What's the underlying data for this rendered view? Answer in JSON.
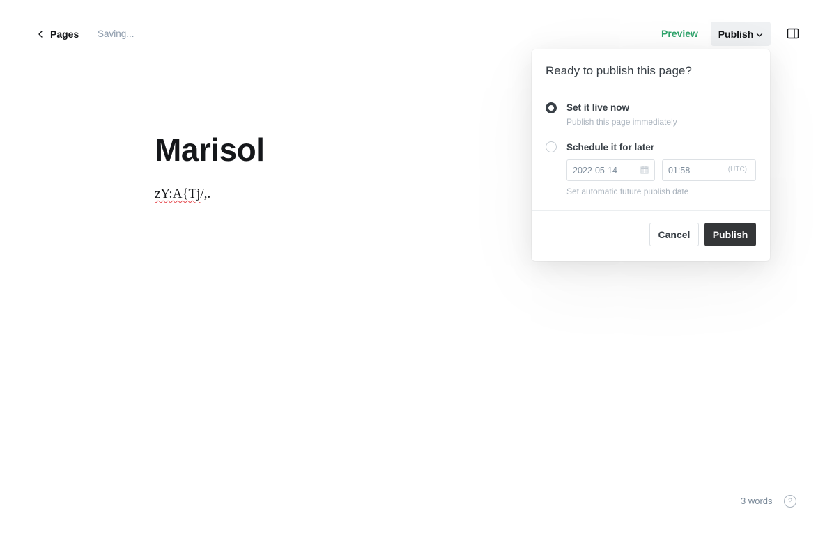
{
  "header": {
    "back_label": "Pages",
    "status": "Saving...",
    "preview_label": "Preview",
    "publish_label": "Publish",
    "back_icon": "chevron-left-icon",
    "publish_icon": "chevron-down-icon",
    "sidebar_icon": "sidebar-toggle-icon"
  },
  "editor": {
    "title": "Marisol",
    "body_misspelled": "zY:A{Tj",
    "body_rest": "/,."
  },
  "publish_menu": {
    "heading": "Ready to publish this page?",
    "options": [
      {
        "label": "Set it live now",
        "description": "Publish this page immediately",
        "selected": true
      },
      {
        "label": "Schedule it for later",
        "description": "Set automatic future publish date",
        "selected": false
      }
    ],
    "schedule": {
      "date": "2022-05-14",
      "time": "01:58",
      "timezone": "(UTC)",
      "date_icon": "calendar-icon"
    },
    "cancel_label": "Cancel",
    "confirm_label": "Publish"
  },
  "footer": {
    "word_count": "3 words",
    "help_label": "?",
    "help_icon": "help-icon"
  },
  "colors": {
    "preview": "#30a46c",
    "publish_button": "#343638",
    "text": "#15171a",
    "muted": "#abb4be"
  }
}
